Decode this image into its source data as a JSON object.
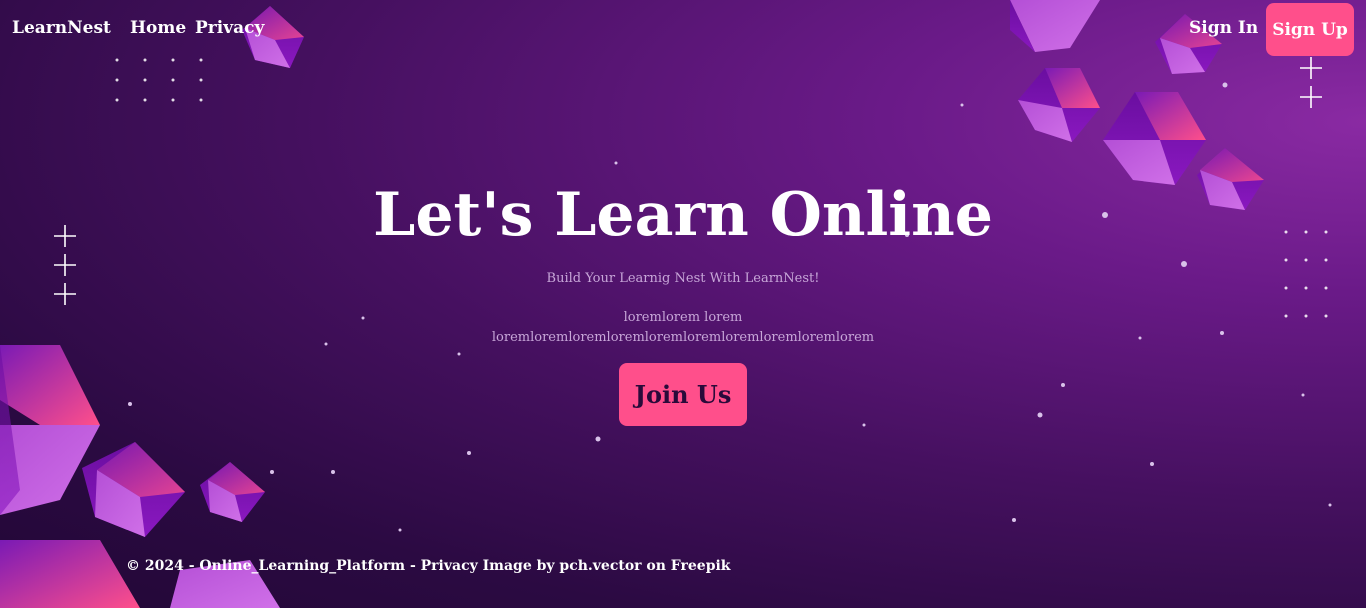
{
  "nav": {
    "brand": "LearnNest",
    "links": [
      "Home",
      "Privacy"
    ],
    "sign_in": "Sign In",
    "sign_up": "Sign Up"
  },
  "hero": {
    "title": "Let's Learn Online",
    "subtitle": "Build Your Learnig Nest With LearnNest!",
    "lorem_line1": "loremlorem lorem",
    "lorem_line2": "loremloremloremloremloremloremloremloremloremlorem",
    "cta": "Join Us"
  },
  "footer": {
    "copyright": "© 2024 - Online_Learning_Platform - Privacy",
    "credit": "Image by pch.vector on Freepik"
  },
  "colors": {
    "accent": "#ff4f8b",
    "background_dark": "#2b0a42",
    "background_light": "#8a2aa3"
  }
}
